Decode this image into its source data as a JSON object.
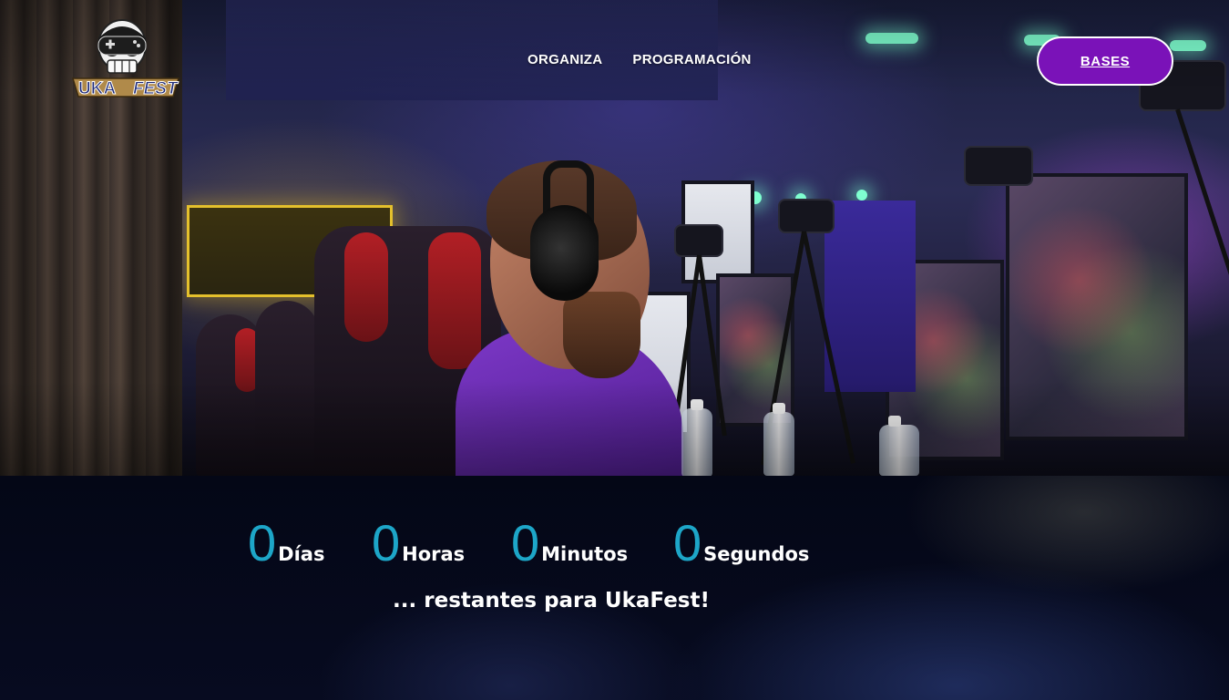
{
  "header": {
    "logo_text_left": "UKA",
    "logo_text_right": "FEST",
    "nav": [
      {
        "label": "ORGANIZA"
      },
      {
        "label": "PROGRAMACIÓN"
      }
    ],
    "cta_label": "BASES"
  },
  "countdown": {
    "days": {
      "value": "0",
      "label": "Días"
    },
    "hours": {
      "value": "0",
      "label": "Horas"
    },
    "minutes": {
      "value": "0",
      "label": "Minutos"
    },
    "seconds": {
      "value": "0",
      "label": "Segundos"
    },
    "tagline": "... restantes para UkaFest!"
  },
  "colors": {
    "accent_purple": "#7a12b8",
    "countdown_number": "#1da6c8",
    "section_background": "#05081a"
  }
}
